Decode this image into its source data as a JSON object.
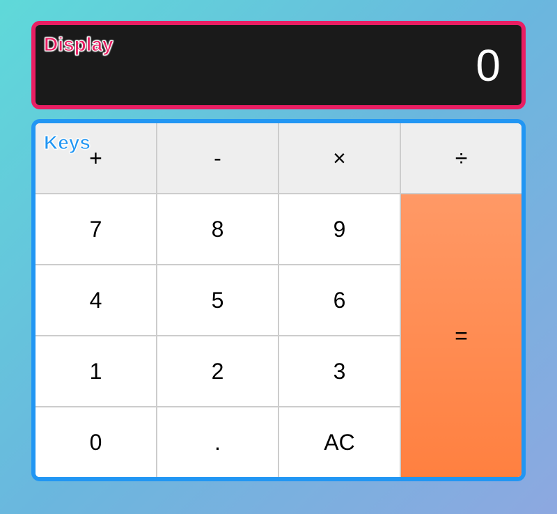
{
  "display": {
    "label": "Display",
    "value": "0"
  },
  "keys": {
    "label": "Keys",
    "operators": {
      "add": "+",
      "subtract": "-",
      "multiply": "×",
      "divide": "÷"
    },
    "digits": {
      "7": "7",
      "8": "8",
      "9": "9",
      "4": "4",
      "5": "5",
      "6": "6",
      "1": "1",
      "2": "2",
      "3": "3",
      "0": "0"
    },
    "decimal": ".",
    "clear": "AC",
    "equals": "="
  }
}
